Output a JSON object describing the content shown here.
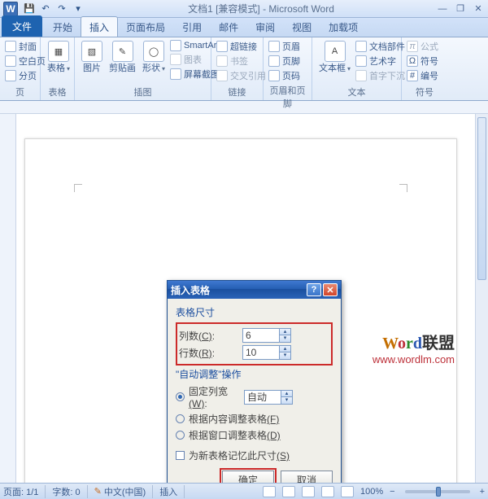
{
  "qat": {
    "save_tip": "💾",
    "undo_tip": "↶",
    "redo_tip": "↷",
    "more": "▾"
  },
  "title": "文档1 [兼容模式] - Microsoft Word",
  "window_buttons": {
    "min": "—",
    "restore": "❐",
    "close": "✕"
  },
  "tabs": {
    "file": "文件",
    "home": "开始",
    "insert": "插入",
    "layout": "页面布局",
    "ref": "引用",
    "mail": "邮件",
    "review": "审阅",
    "view": "视图",
    "addins": "加载项"
  },
  "ribbon": {
    "pages": {
      "title": "页",
      "cover": "封面",
      "blank": "空白页",
      "break": "分页"
    },
    "tables": {
      "title": "表格",
      "btn": "表格"
    },
    "illus": {
      "title": "插图",
      "pic": "图片",
      "clipart": "剪贴画",
      "shapes": "形状",
      "smartart": "SmartArt",
      "chart": "图表",
      "screenshot": "屏幕截图"
    },
    "links": {
      "title": "链接",
      "hyperlink": "超链接",
      "bookmark": "书签",
      "crossref": "交叉引用"
    },
    "headerfooter": {
      "title": "页眉和页脚",
      "header": "页眉",
      "footer": "页脚",
      "pageno": "页码"
    },
    "text": {
      "title": "文本",
      "textbox": "文本框",
      "quickparts": "文档部件",
      "wordart": "艺术字",
      "dropcap": "首字下沉"
    },
    "symbols": {
      "title": "符号",
      "equation": "公式",
      "symbol": "符号",
      "number": "编号"
    }
  },
  "dialog": {
    "title": "插入表格",
    "size_title": "表格尺寸",
    "cols_label": "列数",
    "cols_key": "(C)",
    "cols_value": "6",
    "rows_label": "行数",
    "rows_key": "(R)",
    "rows_value": "10",
    "autofit_title": "\"自动调整\"操作",
    "fixed_label": "固定列宽",
    "fixed_key": "(W)",
    "fixed_value": "自动",
    "fitcontent": "根据内容调整表格",
    "fitcontent_key": "(F)",
    "fitwindow": "根据窗口调整表格",
    "fitwindow_key": "(D)",
    "remember": "为新表格记忆此尺寸",
    "remember_key": "(S)",
    "ok": "确定",
    "cancel": "取消",
    "help": "?",
    "close": "✕"
  },
  "watermark": {
    "l1a": "W",
    "l1b": "o",
    "l1c": "r",
    "l1d": "d",
    "l1cn": "联盟",
    "l2": "www.wordlm.com"
  },
  "status": {
    "page": "页面: 1/1",
    "words": "字数: 0",
    "lang": "中文(中国)",
    "mode": "插入",
    "zoom": "100%",
    "minus": "−",
    "plus": "+"
  }
}
